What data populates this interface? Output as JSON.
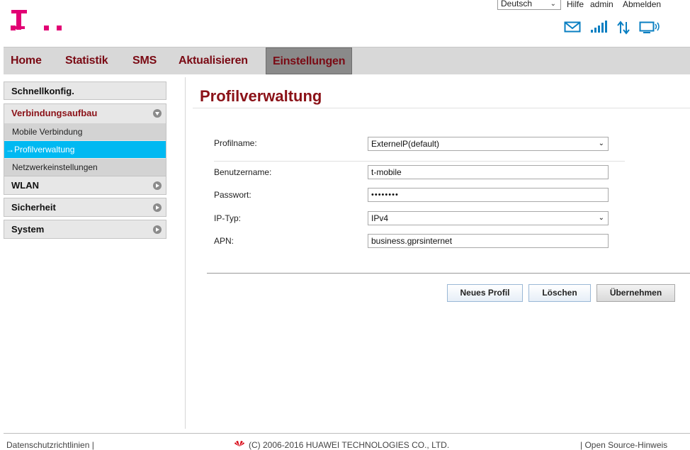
{
  "header": {
    "language": "Deutsch",
    "links": {
      "help": "Hilfe",
      "user": "admin",
      "logout": "Abmelden"
    },
    "brand_color": "#e20074",
    "status_icons": [
      "mail-icon",
      "signal-icon",
      "data-transfer-icon",
      "connection-icon"
    ]
  },
  "nav": {
    "items": [
      "Home",
      "Statistik",
      "SMS",
      "Aktualisieren",
      "Einstellungen"
    ],
    "active": "Einstellungen"
  },
  "sidebar": {
    "quick_setup": "Schnellkonfig.",
    "connection": {
      "label": "Verbindungsaufbau",
      "items": [
        "Mobile Verbindung",
        "Profilverwaltung",
        "Netzwerkeinstellungen"
      ],
      "selected": "Profilverwaltung",
      "selected_prefix": "→"
    },
    "wlan": "WLAN",
    "security": "Sicherheit",
    "system": "System"
  },
  "main": {
    "title": "Profilverwaltung",
    "fields": {
      "profile_label": "Profilname:",
      "profile_value": "ExternelP(default)",
      "username_label": "Benutzername:",
      "username_value": "t-mobile",
      "password_label": "Passwort:",
      "password_value": "••••••••",
      "iptype_label": "IP-Typ:",
      "iptype_value": "IPv4",
      "apn_label": "APN:",
      "apn_value": "business.gprsinternet"
    },
    "buttons": {
      "new_profile": "Neues Profil",
      "delete": "Löschen",
      "apply": "Übernehmen"
    }
  },
  "footer": {
    "privacy": "Datenschutzrichtlinien |",
    "copyright": "(C) 2006-2016 HUAWEI TECHNOLOGIES CO., LTD.",
    "opensource": "| Open Source-Hinweis"
  }
}
